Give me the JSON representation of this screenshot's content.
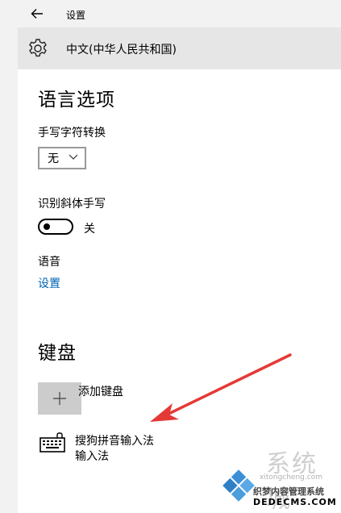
{
  "window": {
    "title": "设置"
  },
  "header": {
    "title": "中文(中华人民共和国)"
  },
  "language_options": {
    "section_title": "语言选项",
    "handwriting_label": "手写字符转换",
    "handwriting_value": "无",
    "italic_label": "识别斜体手写",
    "italic_toggle_state": "关",
    "speech_label": "语音",
    "speech_link": "设置"
  },
  "keyboard": {
    "section_title": "键盘",
    "add_label": "添加键盘",
    "items": [
      {
        "name": "搜狗拼音输入法",
        "subtitle": "输入法"
      }
    ]
  },
  "watermark": {
    "brand": "系统城",
    "url_small": "xitongcheng.com",
    "site_name": "织梦内容管理系统",
    "domain": "DEDECMS.COM"
  },
  "colors": {
    "link": "#0063b1",
    "arrow": "#e53935",
    "chrome": "#f2f2f2",
    "header": "#e6e6e6",
    "add_box": "#cccccc"
  }
}
